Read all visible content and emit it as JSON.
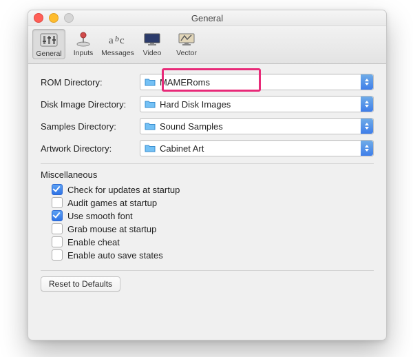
{
  "window": {
    "title": "General"
  },
  "toolbar": {
    "items": [
      {
        "id": "general",
        "label": "General",
        "selected": true
      },
      {
        "id": "inputs",
        "label": "Inputs",
        "selected": false
      },
      {
        "id": "messages",
        "label": "Messages",
        "selected": false
      },
      {
        "id": "video",
        "label": "Video",
        "selected": false
      },
      {
        "id": "vector",
        "label": "Vector",
        "selected": false
      }
    ]
  },
  "directories": [
    {
      "label": "ROM Directory:",
      "value": "MAMERoms",
      "highlighted": true
    },
    {
      "label": "Disk Image Directory:",
      "value": "Hard Disk Images",
      "highlighted": false
    },
    {
      "label": "Samples Directory:",
      "value": "Sound Samples",
      "highlighted": false
    },
    {
      "label": "Artwork Directory:",
      "value": "Cabinet Art",
      "highlighted": false
    }
  ],
  "misc": {
    "title": "Miscellaneous",
    "options": [
      {
        "label": "Check for updates at startup",
        "checked": true
      },
      {
        "label": "Audit games at startup",
        "checked": false
      },
      {
        "label": "Use smooth font",
        "checked": true
      },
      {
        "label": "Grab mouse at startup",
        "checked": false
      },
      {
        "label": "Enable cheat",
        "checked": false
      },
      {
        "label": "Enable auto save states",
        "checked": false
      }
    ]
  },
  "buttons": {
    "reset": "Reset to Defaults"
  },
  "annotation": {
    "highlight_color": "#e82a78"
  }
}
